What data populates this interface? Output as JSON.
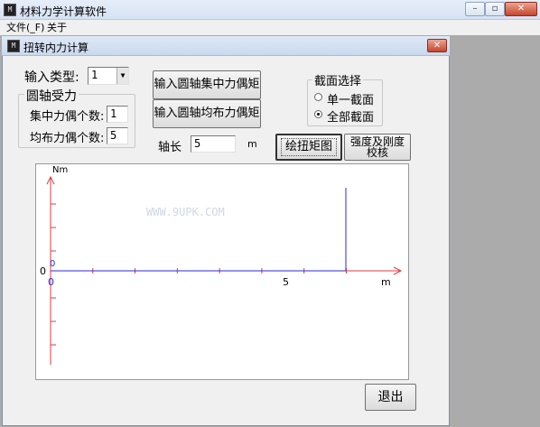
{
  "app": {
    "title": "材料力学计算软件",
    "icon_text": "M"
  },
  "menu": {
    "file": "文件(_F)",
    "about": "关于"
  },
  "child": {
    "title": "扭转内力计算",
    "icon_text": "M"
  },
  "form": {
    "input_type_label": "输入类型:",
    "input_type_value": "1",
    "group_title": "圆轴受力",
    "concentrated_label": "集中力偶个数:",
    "concentrated_value": "1",
    "distributed_label": "均布力偶个数:",
    "distributed_value": "5",
    "axis_length_label": "轴长",
    "axis_length_value": "5",
    "axis_length_unit": "m"
  },
  "buttons": {
    "input_concentrated": "输入圆轴集中力偶矩",
    "input_distributed": "输入圆轴均布力偶矩",
    "draw_torque": "绘扭矩图",
    "strength_check_line1": "强度及刚度",
    "strength_check_line2": "校核",
    "exit": "退出"
  },
  "section": {
    "title": "截面选择",
    "single": "单一截面",
    "all": "全部截面",
    "selected": "all"
  },
  "chart_data": {
    "type": "line",
    "ylabel": "Nm",
    "xunit": "m",
    "origin_label": "0",
    "x_tick_labels": [
      "0",
      "5"
    ],
    "x_ticks": [
      0,
      5
    ],
    "y_axis_zero_label": "0",
    "xlim": [
      0,
      6
    ],
    "series": [
      {
        "values": [
          {
            "x": 0,
            "y": 0
          },
          {
            "x": 5,
            "y": 0
          }
        ],
        "color": "#2b2bd6"
      }
    ],
    "impulse": {
      "x": 5,
      "color": "#2b2bd6"
    }
  },
  "watermark": "WWW.9UPK.COM",
  "colors": {
    "axis": "#e03c3c",
    "series": "#2b2bd6"
  }
}
